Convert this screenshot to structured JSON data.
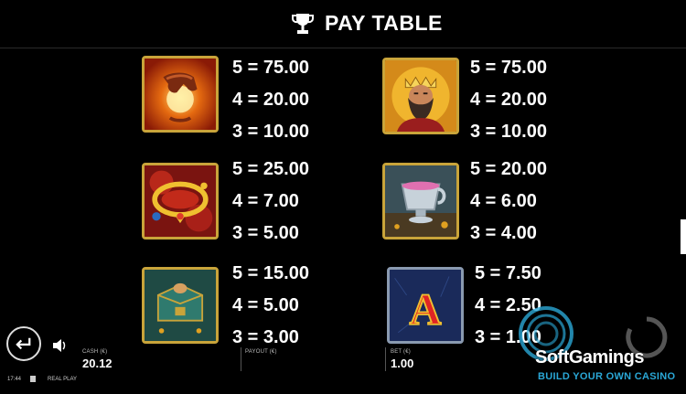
{
  "header": {
    "title": "PAY TABLE",
    "icon": "trophy-icon"
  },
  "symbols": [
    {
      "name": "hand-fire",
      "pays": [
        "5 = 75.00",
        "4 = 20.00",
        "3 = 10.00"
      ]
    },
    {
      "name": "king",
      "pays": [
        "5 = 75.00",
        "4 = 20.00",
        "3 = 10.00"
      ]
    },
    {
      "name": "necklace",
      "pays": [
        "5 = 25.00",
        "4 = 7.00",
        "3 = 5.00"
      ]
    },
    {
      "name": "goblet",
      "pays": [
        "5 = 20.00",
        "4 = 6.00",
        "3 = 4.00"
      ]
    },
    {
      "name": "chest",
      "pays": [
        "5 = 15.00",
        "4 = 5.00",
        "3 = 3.00"
      ]
    },
    {
      "name": "letter-a",
      "letter": "A",
      "pays": [
        "5 = 7.50",
        "4 = 2.50",
        "3 = 1.00"
      ]
    }
  ],
  "footer": {
    "cash_label": "CASH (€)",
    "cash_value": "20.12",
    "payout_label": "PAYOUT (€)",
    "bet_label": "BET (€)",
    "bet_value": "1.00",
    "time": "17:44",
    "mode": "REAL PLAY"
  },
  "watermark": {
    "brand": "SoftGamings",
    "tagline": "BUILD YOUR OWN CASINO"
  },
  "colors": {
    "background": "#000000",
    "frame_gold": "#c9a43a",
    "accent_blue": "#2aa7d6"
  }
}
